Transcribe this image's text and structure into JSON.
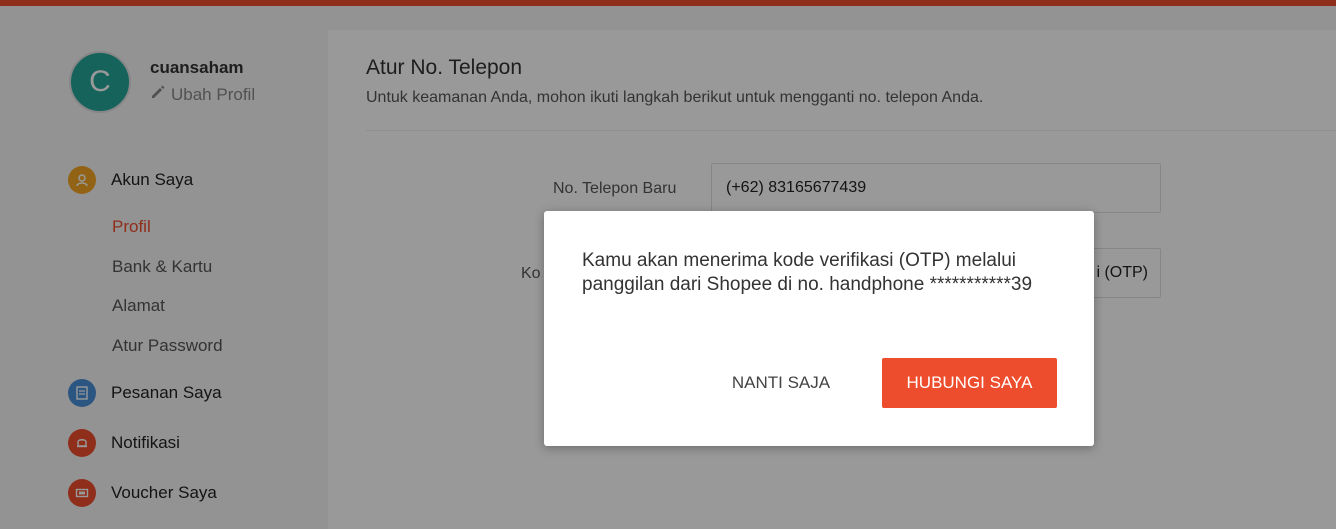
{
  "user": {
    "avatar_initial": "C",
    "username": "cuansaham",
    "edit_profile_label": "Ubah Profil"
  },
  "sidebar": {
    "account": {
      "label": "Akun Saya",
      "icon": "person-icon"
    },
    "sub_items": [
      {
        "label": "Profil",
        "active": true
      },
      {
        "label": "Bank & Kartu"
      },
      {
        "label": "Alamat"
      },
      {
        "label": "Atur Password"
      }
    ],
    "items": [
      {
        "label": "Pesanan Saya",
        "icon": "orders-icon",
        "color": "#4a90d9"
      },
      {
        "label": "Notifikasi",
        "icon": "bell-icon",
        "color": "#ee4d2d"
      },
      {
        "label": "Voucher Saya",
        "icon": "voucher-icon",
        "color": "#ee4d2d"
      }
    ]
  },
  "main": {
    "title": "Atur No. Telepon",
    "subtitle": "Untuk keamanan Anda, mohon ikuti langkah berikut untuk mengganti no. telepon Anda.",
    "phone_label": "No. Telepon Baru",
    "phone_value": "(+62) 83165677439",
    "otp_label_partial": "Ko",
    "otp_button_partial": "i (OTP)"
  },
  "dialog": {
    "message": "Kamu akan menerima kode verifikasi (OTP) melalui panggilan dari Shopee di no. handphone ***********39",
    "later_label": "NANTI SAJA",
    "call_label": "HUBUNGI SAYA"
  },
  "colors": {
    "accent": "#ee4d2d",
    "avatar": "#26a69a",
    "account_icon": "#f5a623"
  }
}
